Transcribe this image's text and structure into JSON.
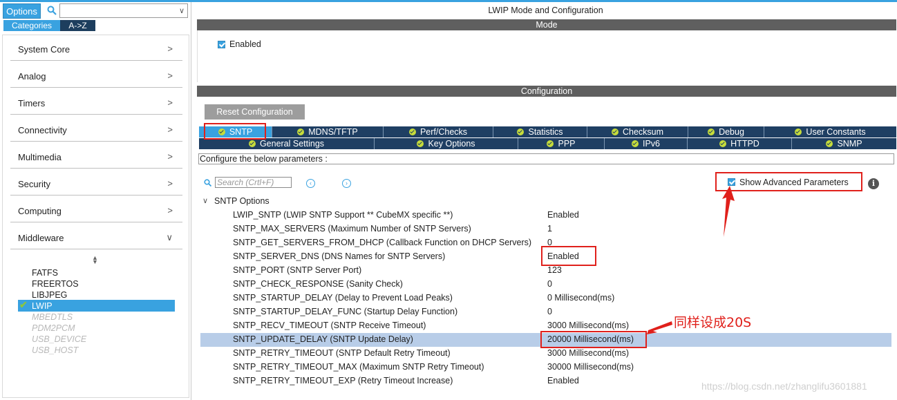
{
  "left_panel": {
    "options_label": "Options",
    "search_value": "",
    "tabs": [
      "Categories",
      "A->Z"
    ],
    "categories": [
      "System Core",
      "Analog",
      "Timers",
      "Connectivity",
      "Multimedia",
      "Security",
      "Computing",
      "Middleware"
    ],
    "middleware_items": [
      {
        "label": "FATFS",
        "state": "normal"
      },
      {
        "label": "FREERTOS",
        "state": "normal"
      },
      {
        "label": "LIBJPEG",
        "state": "normal"
      },
      {
        "label": "LWIP",
        "state": "selected"
      },
      {
        "label": "MBEDTLS",
        "state": "disabled"
      },
      {
        "label": "PDM2PCM",
        "state": "disabled"
      },
      {
        "label": "USB_DEVICE",
        "state": "disabled"
      },
      {
        "label": "USB_HOST",
        "state": "disabled"
      }
    ]
  },
  "main": {
    "title": "LWIP Mode and Configuration",
    "mode_header": "Mode",
    "mode_enabled_label": "Enabled",
    "config_header": "Configuration",
    "reset_button": "Reset Configuration",
    "tabs_row1": [
      "SNTP",
      "MDNS/TFTP",
      "Perf/Checks",
      "Statistics",
      "Checksum",
      "Debug",
      "User Constants"
    ],
    "tabs_row2": [
      "General Settings",
      "Key Options",
      "PPP",
      "IPv6",
      "HTTPD",
      "SNMP"
    ],
    "configure_text": "Configure the below parameters :",
    "search_placeholder": "Search (Crtl+F)",
    "show_advanced_label": "Show Advanced Parameters",
    "group_title": "SNTP Options",
    "params": [
      {
        "name": "LWIP_SNTP (LWIP SNTP Support ** CubeMX specific **)",
        "value": "Enabled"
      },
      {
        "name": "SNTP_MAX_SERVERS (Maximum Number of SNTP Servers)",
        "value": "1"
      },
      {
        "name": "SNTP_GET_SERVERS_FROM_DHCP (Callback Function on DHCP Servers)",
        "value": "0"
      },
      {
        "name": "SNTP_SERVER_DNS (DNS Names for SNTP Servers)",
        "value": "Enabled"
      },
      {
        "name": "SNTP_PORT (SNTP Server Port)",
        "value": "123"
      },
      {
        "name": "SNTP_CHECK_RESPONSE (Sanity Check)",
        "value": "0"
      },
      {
        "name": "SNTP_STARTUP_DELAY (Delay to Prevent Load Peaks)",
        "value": "0 Millisecond(ms)"
      },
      {
        "name": "SNTP_STARTUP_DELAY_FUNC (Startup Delay Function)",
        "value": "0"
      },
      {
        "name": "SNTP_RECV_TIMEOUT (SNTP Receive Timeout)",
        "value": "3000 Millisecond(ms)"
      },
      {
        "name": "SNTP_UPDATE_DELAY (SNTP Update Delay)",
        "value": "20000 Millisecond(ms)"
      },
      {
        "name": "SNTP_RETRY_TIMEOUT (SNTP Default Retry Timeout)",
        "value": "3000 Millisecond(ms)"
      },
      {
        "name": "SNTP_RETRY_TIMEOUT_MAX (Maximum SNTP Retry Timeout)",
        "value": "30000 Millisecond(ms)"
      },
      {
        "name": "SNTP_RETRY_TIMEOUT_EXP (Retry Timeout Increase)",
        "value": "Enabled"
      }
    ]
  },
  "annotation": {
    "text": "同样设成20S",
    "color": "#e0201b"
  },
  "watermark": "https://blog.csdn.net/zhanglifu3601881",
  "colors": {
    "accent": "#39a2e0",
    "tab_bg": "#1f3f63",
    "header_bg": "#5f5f5f",
    "highlight_row": "#b8cde8"
  }
}
